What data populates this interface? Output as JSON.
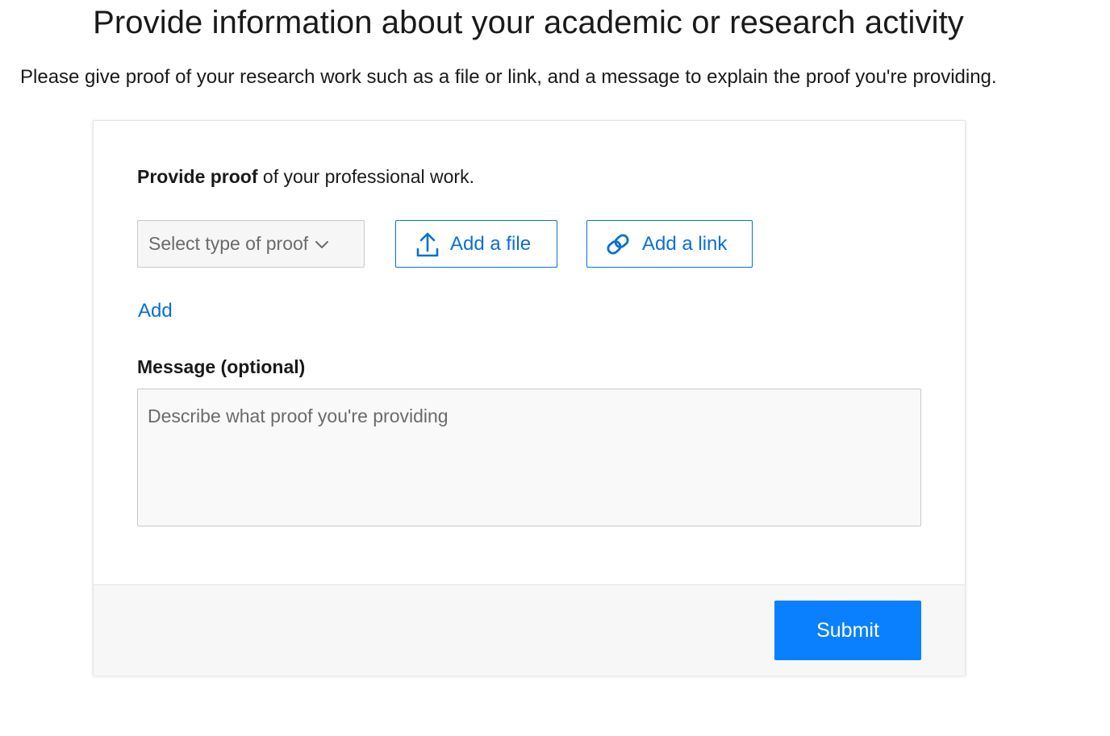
{
  "header": {
    "title": "Provide information about your academic or research activity",
    "subtitle": "Please give proof of your research work such as a file or link, and a message to explain the proof you're providing."
  },
  "form": {
    "proof_heading_bold": "Provide proof",
    "proof_heading_rest": " of your professional work.",
    "select_proof": {
      "placeholder": "Select type of proof",
      "icon": "chevron-down-icon"
    },
    "add_file_button": {
      "label": "Add a file",
      "icon": "upload-icon"
    },
    "add_link_button": {
      "label": "Add a link",
      "icon": "link-icon"
    },
    "add_label": "Add",
    "message": {
      "label": "Message (optional)",
      "placeholder": "Describe what proof you're providing",
      "value": ""
    },
    "submit_label": "Submit"
  },
  "colors": {
    "accent": "#0a6fd6",
    "primary_button": "#0a80ff",
    "footer_background": "#f7f7f7"
  }
}
